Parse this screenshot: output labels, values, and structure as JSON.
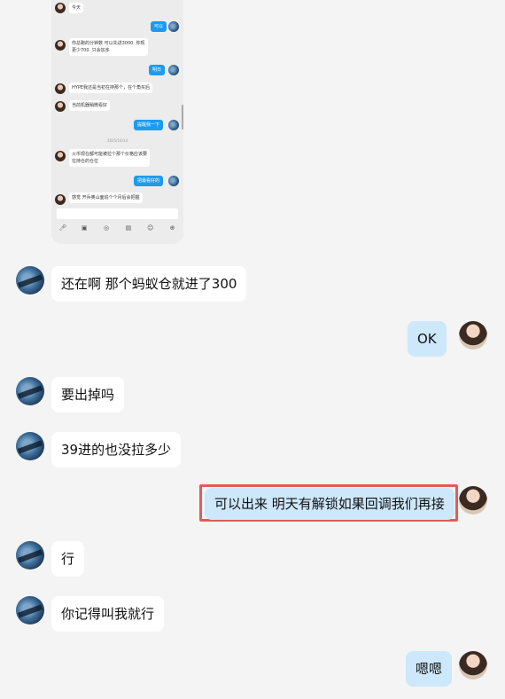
{
  "embedded_screenshot": {
    "messages": [
      {
        "side": "in",
        "text": "今天"
      },
      {
        "side": "out",
        "text": "可以"
      },
      {
        "side": "in",
        "text": "你总跑的分钟数 可以先进3000  你现\n更少700  只会加多"
      },
      {
        "side": "out",
        "text": "明日"
      },
      {
        "side": "in",
        "text": "HYPE我还是当初在持那个，在个角买后"
      },
      {
        "side": "in",
        "text": "当前机器稍微看好"
      },
      {
        "side": "out",
        "text": "提醒我一下"
      },
      {
        "side": "in",
        "text": "火币现在都可能被拉个那个价格应该要\n在持仓的仓位"
      },
      {
        "side": "out",
        "text": "把最看好的"
      },
      {
        "side": "in",
        "text": "感觉 开兵奥山面追个个月后会把握"
      }
    ],
    "timestamp": "2025/10/14",
    "toolbar_icons": [
      "mic-icon",
      "image-icon",
      "camera-icon",
      "gif-icon",
      "emoji-icon",
      "plus-icon"
    ]
  },
  "messages": [
    {
      "side": "in",
      "text": "还在啊 那个蚂蚁仓就进了300"
    },
    {
      "side": "out",
      "text": "OK"
    },
    {
      "side": "in",
      "text": "要出掉吗"
    },
    {
      "side": "in",
      "text": "39进的也没拉多少"
    },
    {
      "side": "out",
      "text": "可以出来  明天有解锁如果回调我们再接",
      "highlighted": true
    },
    {
      "side": "in",
      "text": "行"
    },
    {
      "side": "in",
      "text": "你记得叫我就行"
    },
    {
      "side": "out",
      "text": "嗯嗯"
    }
  ],
  "colors": {
    "background": "#f4f4f4",
    "bubble_in": "#ffffff",
    "bubble_out": "#cde8fb",
    "highlight": "#e35a5a",
    "mini_out": "#1d9bf0"
  }
}
